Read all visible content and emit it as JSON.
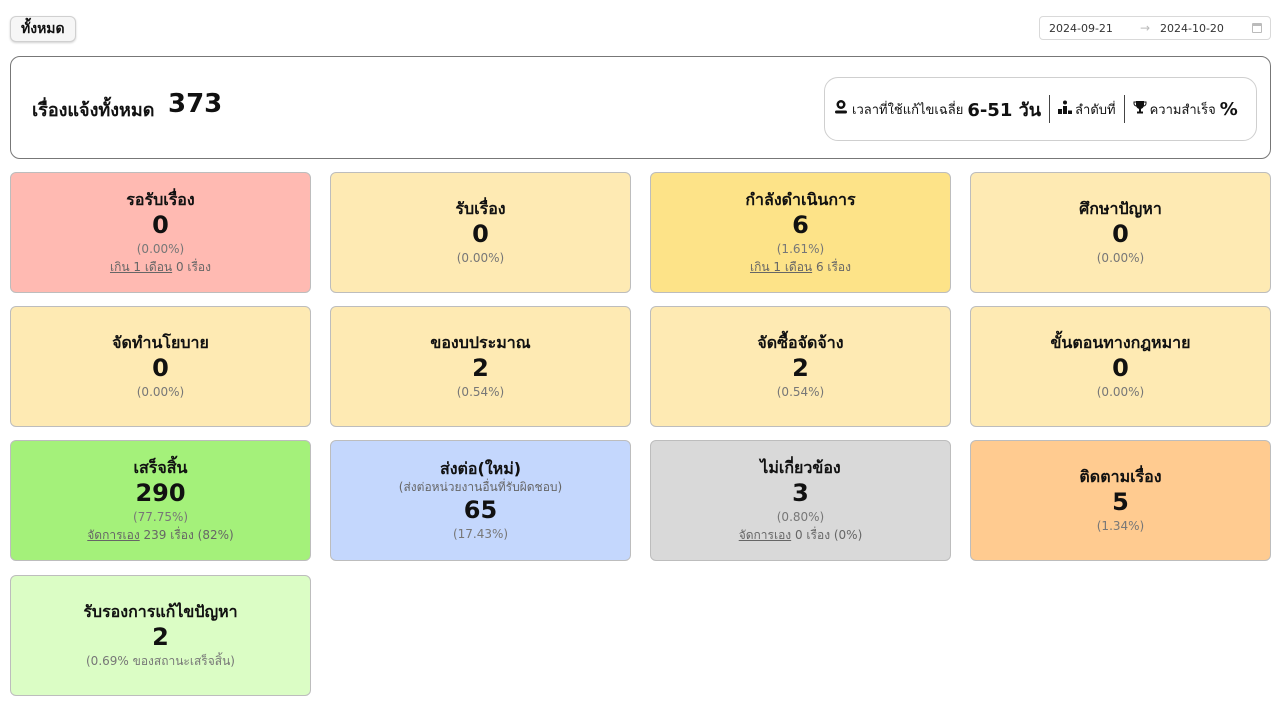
{
  "filter": {
    "label": "ทั้งหมด"
  },
  "date_range": {
    "start": "2024-09-21",
    "end": "2024-10-20",
    "arrow": "→"
  },
  "summary": {
    "label": "เรื่องแจ้งทั้งหมด",
    "total": "373",
    "avg_time_label": "เวลาที่ใช้แก้ไขเฉลี่ย",
    "avg_time_value": "6-51 วัน",
    "rank_label": "ลำดับที่",
    "success_label": "ความสำเร็จ",
    "success_value": "%"
  },
  "cards": [
    {
      "title": "รอรับเรื่อง",
      "count": "0",
      "pct": "(0.00%)",
      "note_link": "เกิน 1 เดือน",
      "note_rest": " 0 เรื่อง",
      "color": "#ffbab2"
    },
    {
      "title": "รับเรื่อง",
      "count": "0",
      "pct": "(0.00%)",
      "color": "#feeab3"
    },
    {
      "title": "กำลังดำเนินการ",
      "count": "6",
      "pct": "(1.61%)",
      "note_link": "เกิน 1 เดือน",
      "note_rest": " 6 เรื่อง",
      "color": "#fde388"
    },
    {
      "title": "ศึกษาปัญหา",
      "count": "0",
      "pct": "(0.00%)",
      "color": "#feeab3"
    },
    {
      "title": "จัดทำนโยบาย",
      "count": "0",
      "pct": "(0.00%)",
      "color": "#feeab3"
    },
    {
      "title": "ของบประมาณ",
      "count": "2",
      "pct": "(0.54%)",
      "color": "#feeab3"
    },
    {
      "title": "จัดซื้อจัดจ้าง",
      "count": "2",
      "pct": "(0.54%)",
      "color": "#feeab3"
    },
    {
      "title": "ขั้นตอนทางกฎหมาย",
      "count": "0",
      "pct": "(0.00%)",
      "color": "#feeab3"
    },
    {
      "title": "เสร็จสิ้น",
      "count": "290",
      "pct": "(77.75%)",
      "note_link": "จัดการเอง",
      "note_rest": " 239 เรื่อง (82%)",
      "color": "#a4f17a"
    },
    {
      "title": "ส่งต่อ(ใหม่)",
      "subtitle": "(ส่งต่อหน่วยงานอื่นที่รับผิดชอบ)",
      "count": "65",
      "pct": "(17.43%)",
      "color": "#c4d7fd"
    },
    {
      "title": "ไม่เกี่ยวข้อง",
      "count": "3",
      "pct": "(0.80%)",
      "note_link": "จัดการเอง",
      "note_rest": " 0 เรื่อง (0%)",
      "color": "#d9d9d9"
    },
    {
      "title": "ติดตามเรื่อง",
      "count": "5",
      "pct": "(1.34%)",
      "color": "#ffcb90"
    },
    {
      "title": "รับรองการแก้ไขปัญหา",
      "count": "2",
      "pct": "(0.69% ของสถานะเสร็จสิ้น)",
      "color": "#dbfdc5"
    }
  ]
}
